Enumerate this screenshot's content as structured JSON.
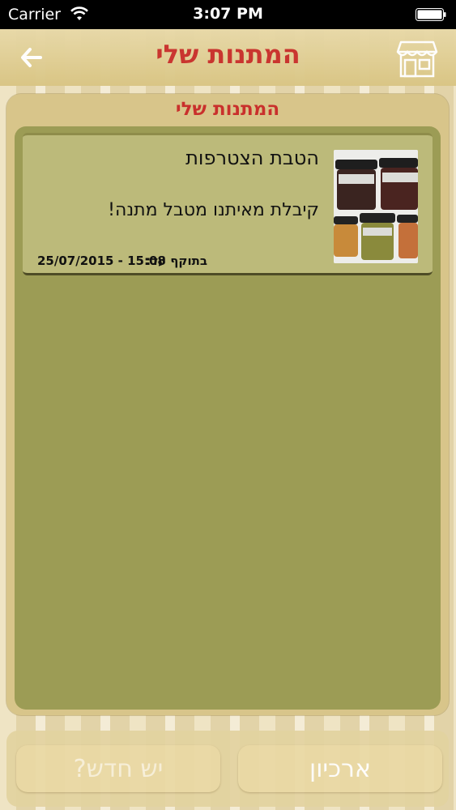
{
  "status_bar": {
    "carrier": "Carrier",
    "time": "3:07 PM"
  },
  "nav": {
    "title": "המתנות שלי"
  },
  "panel": {
    "title": "המתנות שלי"
  },
  "gifts": [
    {
      "title": "הטבת הצטרפות",
      "description": "קיבלת מאיתנו מטבל מתנה!",
      "valid_label": "בתוקף עד:",
      "valid_until": "25/07/2015 - 15:08"
    }
  ],
  "buttons": {
    "whats_new": "יש חדש?",
    "archive": "ארכיון"
  },
  "colors": {
    "accent": "#c9302c",
    "list_bg": "#9c9c55",
    "card_bg": "#bcba7a"
  }
}
